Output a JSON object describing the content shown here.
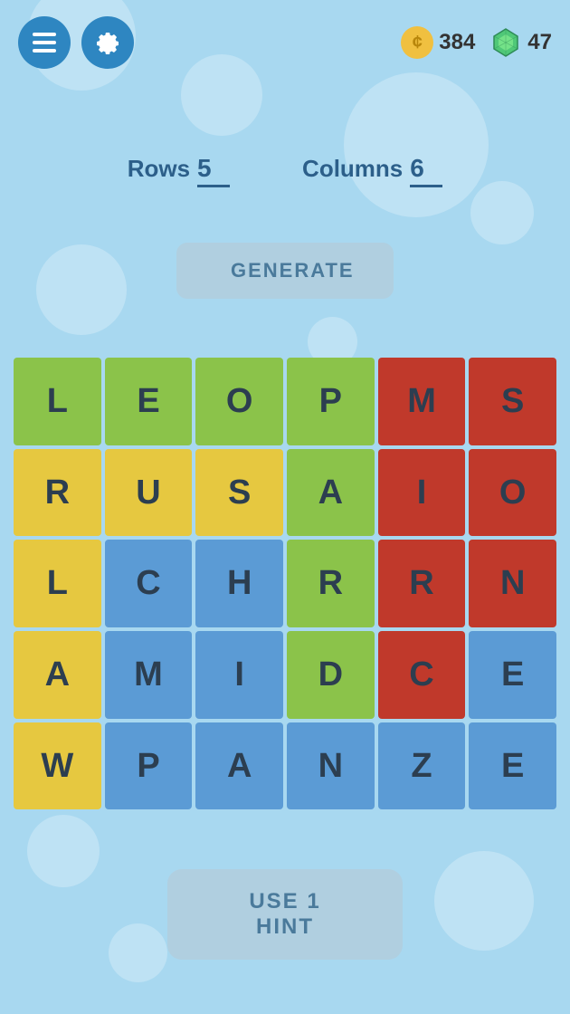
{
  "header": {
    "menu_label": "☰",
    "settings_label": "⚙",
    "coins": "384",
    "gems": "47"
  },
  "controls": {
    "rows_label": "Rows",
    "rows_value": "5",
    "columns_label": "Columns",
    "columns_value": "6"
  },
  "generate_button": "GENERATE",
  "hint_button": "USE 1 HINT",
  "grid": {
    "cells": [
      {
        "letter": "L",
        "color": "green"
      },
      {
        "letter": "E",
        "color": "green"
      },
      {
        "letter": "O",
        "color": "green"
      },
      {
        "letter": "P",
        "color": "green"
      },
      {
        "letter": "M",
        "color": "red"
      },
      {
        "letter": "S",
        "color": "red"
      },
      {
        "letter": "R",
        "color": "yellow"
      },
      {
        "letter": "U",
        "color": "yellow"
      },
      {
        "letter": "S",
        "color": "yellow"
      },
      {
        "letter": "A",
        "color": "green"
      },
      {
        "letter": "I",
        "color": "red"
      },
      {
        "letter": "O",
        "color": "red"
      },
      {
        "letter": "L",
        "color": "yellow"
      },
      {
        "letter": "C",
        "color": "blue"
      },
      {
        "letter": "H",
        "color": "blue"
      },
      {
        "letter": "R",
        "color": "green"
      },
      {
        "letter": "R",
        "color": "red"
      },
      {
        "letter": "N",
        "color": "red"
      },
      {
        "letter": "A",
        "color": "yellow"
      },
      {
        "letter": "M",
        "color": "blue"
      },
      {
        "letter": "I",
        "color": "blue"
      },
      {
        "letter": "D",
        "color": "green"
      },
      {
        "letter": "C",
        "color": "red"
      },
      {
        "letter": "E",
        "color": "blue"
      },
      {
        "letter": "W",
        "color": "yellow"
      },
      {
        "letter": "P",
        "color": "blue"
      },
      {
        "letter": "A",
        "color": "blue"
      },
      {
        "letter": "N",
        "color": "blue"
      },
      {
        "letter": "Z",
        "color": "blue"
      },
      {
        "letter": "E",
        "color": "blue"
      }
    ]
  }
}
